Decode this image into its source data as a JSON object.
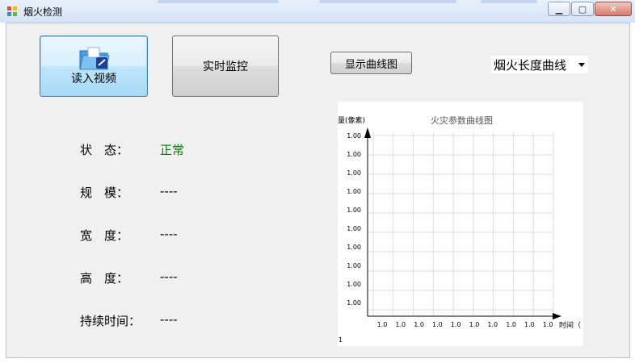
{
  "window": {
    "title": "烟火检测"
  },
  "buttons": {
    "read_video": "读入视频",
    "live_monitor": "实时监控",
    "show_curve": "显示曲线图"
  },
  "select": {
    "value": "烟火长度曲线"
  },
  "stats": [
    {
      "label": "状　态：",
      "value": "正常"
    },
    {
      "label": "规　模：",
      "value": "----"
    },
    {
      "label": "宽　度：",
      "value": "----"
    },
    {
      "label": "高　度：",
      "value": "----"
    },
    {
      "label": "持续时间：",
      "value": "----"
    }
  ],
  "colors": {
    "status_ok": "#008000",
    "accent": "#3c7fb1"
  },
  "chart_data": {
    "type": "line",
    "title": "火灾参数曲线图",
    "ylabel": "量(像素)",
    "xlabel": "时间（",
    "corner_label": "1",
    "y_ticks": [
      "1.00",
      "1.00",
      "1.00",
      "1.00",
      "1.00",
      "1.00",
      "1.00",
      "1.00",
      "1.00",
      "1.00"
    ],
    "x_ticks": [
      "1.0",
      "1.0",
      "1.0",
      "1.0",
      "1.0",
      "1.0",
      "1.0",
      "1.0",
      "1.0",
      "1.0"
    ],
    "series": [],
    "grid": true
  }
}
